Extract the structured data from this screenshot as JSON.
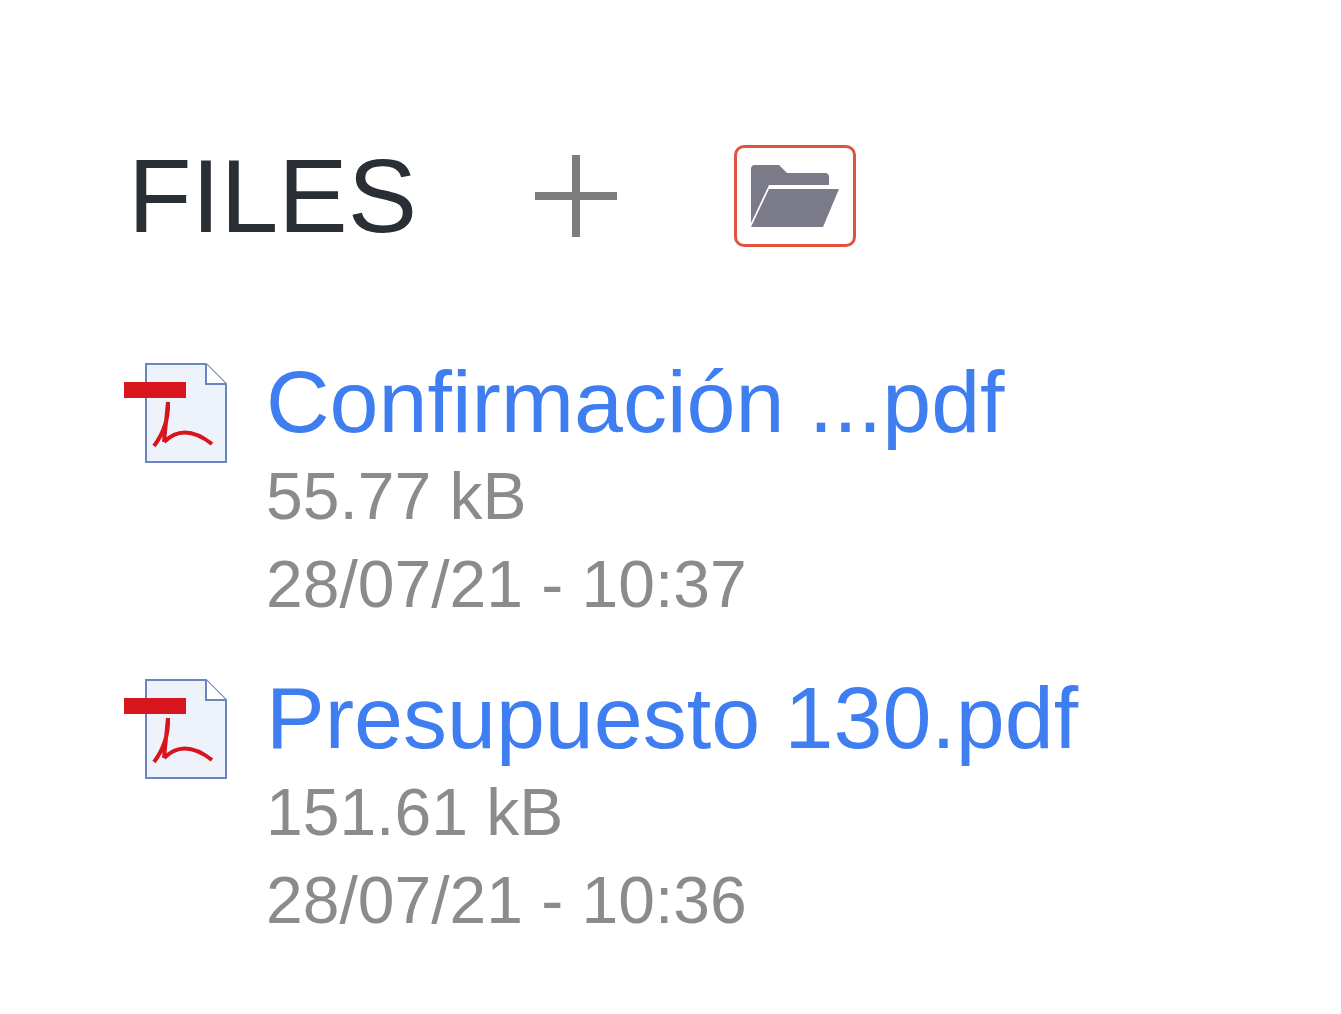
{
  "header": {
    "title": "FILES"
  },
  "files": [
    {
      "name": "Confirmación ...pdf",
      "size": "55.77 kB",
      "date": "28/07/21 - 10:37"
    },
    {
      "name": "Presupuesto 130.pdf",
      "size": "151.61 kB",
      "date": "28/07/21 - 10:36"
    }
  ]
}
